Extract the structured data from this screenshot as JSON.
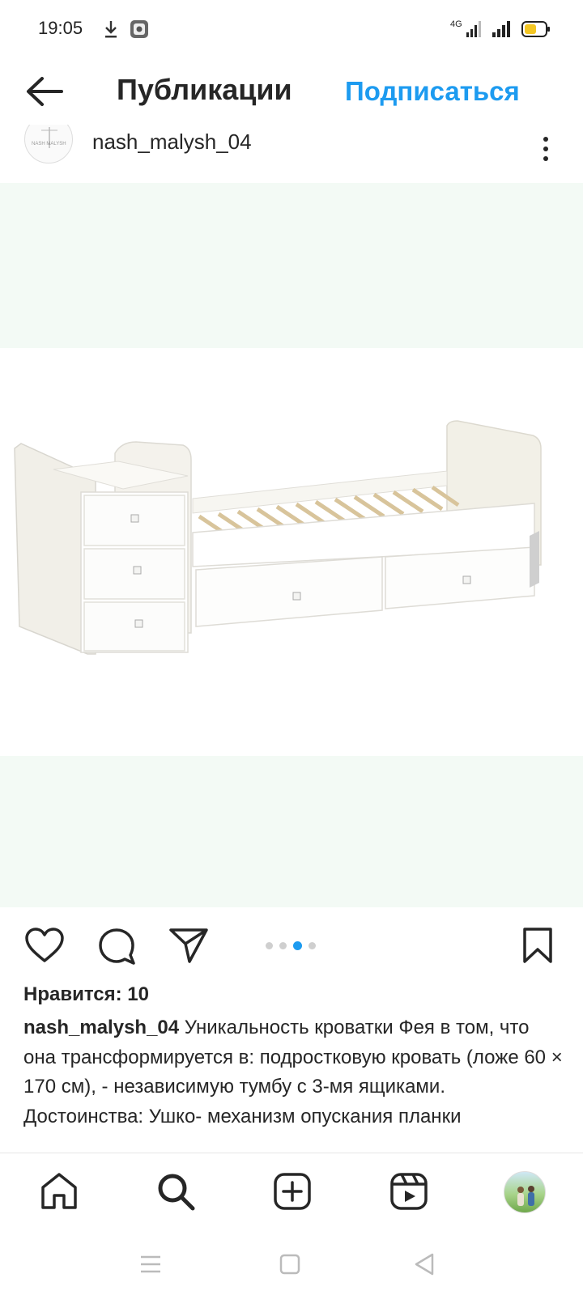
{
  "status_bar": {
    "time": "19:05",
    "network": "4G",
    "icons": [
      "download-icon",
      "notification-icon",
      "signal-icon",
      "battery-icon"
    ]
  },
  "header": {
    "title": "Публикации",
    "subscribe_label": "Подписаться",
    "back_icon": "arrow-left-icon"
  },
  "post": {
    "username": "nash_malysh_04",
    "image_alt_semantic": "white-transformable-crib-with-drawers",
    "carousel": {
      "count": 4,
      "active_index": 2
    },
    "likes": "Нравится: 10",
    "caption_user": "nash_malysh_04",
    "caption_text": "Уникальность кроватки Фея в том, что она трансформируется в: подростковую кровать (ложе 60 × 170 см), - независимую тумбу с 3-мя ящиками. Достоинства: Ушко- механизм опускания планки"
  },
  "bottom_nav": {
    "items": [
      "home-icon",
      "search-icon",
      "add-post-icon",
      "reels-icon",
      "profile-avatar"
    ]
  },
  "system_nav": {
    "items": [
      "menu-icon",
      "home-square-icon",
      "back-triangle-icon"
    ]
  },
  "colors": {
    "accent": "#1d9bf0",
    "text": "#262626",
    "image_bg": "#f3faf5"
  }
}
